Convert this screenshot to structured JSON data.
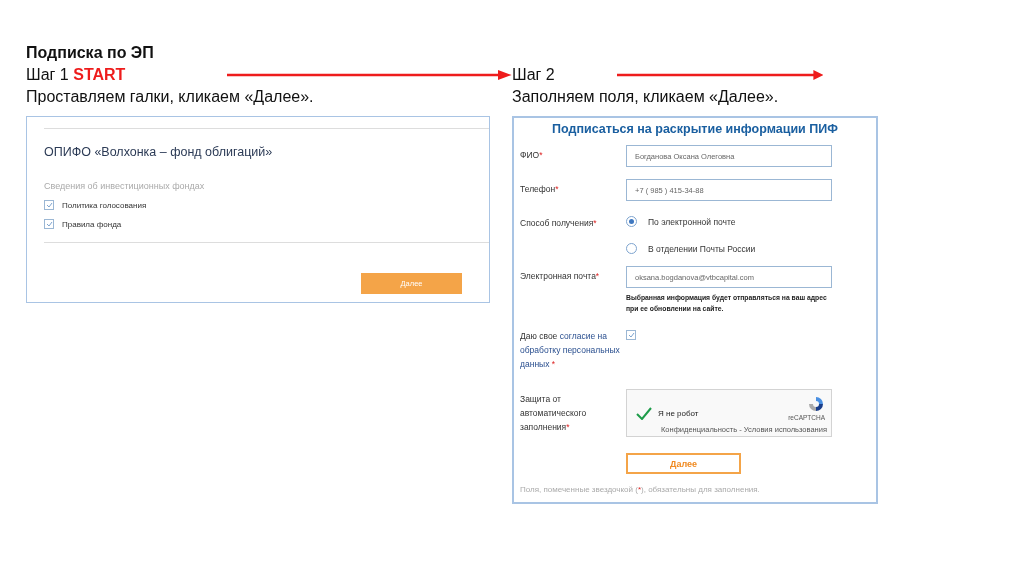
{
  "slide": {
    "title": "Подписка по ЭП",
    "steps": [
      {
        "label": "Шаг 1",
        "tag": "START",
        "instruction": "Проставляем галки, кликаем «Далее»."
      },
      {
        "label": "Шаг 2",
        "instruction": "Заполняем поля, кликаем «Далее»."
      }
    ]
  },
  "step1_form": {
    "fund_title": "ОПИФО «Волхонка – фонд облигаций»",
    "section_label": "Сведения об инвестиционных фондах",
    "checkboxes": [
      {
        "label": "Политика голосования",
        "checked": true
      },
      {
        "label": "Правила фонда",
        "checked": true
      }
    ],
    "button": "Далее"
  },
  "step2_form": {
    "title": "Подписаться на раскрытие информации ПИФ",
    "fields": [
      {
        "kind": "text",
        "label": "ФИО",
        "mark": "*",
        "value": "Богданова Оксана Олеговна"
      },
      {
        "kind": "text",
        "label": "Телефон",
        "mark": "*",
        "value": "+7 ( 985 ) 415-34-88"
      },
      {
        "kind": "radio",
        "label": "Способ получения",
        "mark": "*",
        "options": [
          {
            "label": "По электронной почте",
            "selected": true
          },
          {
            "label": "В отделении Почты России",
            "selected": false
          }
        ]
      },
      {
        "kind": "text",
        "label": "Электронная почта",
        "mark": "*",
        "value": "oksana.bogdanova@vtbcapital.com",
        "hint": "Выбранная информация будет отправляться на ваш адрес при ее обновлении на сайте."
      },
      {
        "kind": "consent",
        "label": "Даю свое ",
        "link": "согласие на обработку персональных данных",
        "mark": " *",
        "checked": true
      },
      {
        "kind": "captcha",
        "label": "Защита от автоматического заполнения",
        "mark": "*",
        "captcha_label": "Я не робот",
        "captcha_brand": "reCAPTCHA",
        "captcha_links": "Конфиденциальность - Условия использования",
        "checked": true
      }
    ],
    "button": "Далее",
    "footnote_before": "Поля, помеченные звездочкой (",
    "footnote_mark": "*",
    "footnote_after": "), обязательны для заполнения."
  }
}
